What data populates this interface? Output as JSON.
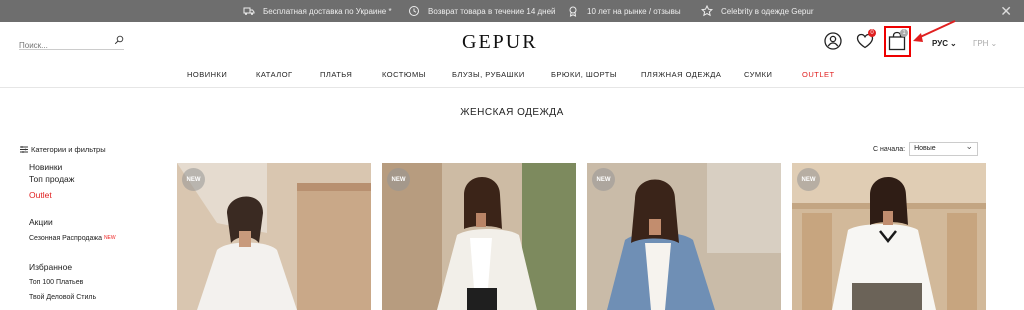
{
  "topbar": {
    "items": [
      {
        "label": "Бесплатная доставка по Украине *"
      },
      {
        "label": "Возврат товара в течение 14 дней"
      },
      {
        "label": "10 лет на рынке / отзывы"
      },
      {
        "label": "Celebrity в одежде Gepur"
      }
    ],
    "close": "✕"
  },
  "search": {
    "placeholder": "Поиск..."
  },
  "logo": "GEPUR",
  "header": {
    "wishlist_count": "0",
    "cart_count": "1",
    "lang": "РУС",
    "currency": "ГРН"
  },
  "nav": [
    "НОВИНКИ",
    "КАТАЛОГ",
    "ПЛАТЬЯ",
    "КОСТЮМЫ",
    "БЛУЗЫ, РУБАШКИ",
    "БРЮКИ, ШОРТЫ",
    "ПЛЯЖНАЯ ОДЕЖДА",
    "СУМКИ",
    "OUTLET"
  ],
  "page_title": "ЖЕНСКАЯ ОДЕЖДА",
  "filters_label": "Категории и фильтры",
  "sidebar": {
    "new": "Новинки",
    "top": "Топ продаж",
    "outlet": "Outlet",
    "promo_head": "Акции",
    "sale": "Сезонная Распродажа",
    "sale_tag": "NEW",
    "fav_head": "Избранное",
    "top100": "Топ 100 Платьев",
    "business": "Твой Деловой Стиль"
  },
  "sort": {
    "label": "С начала:",
    "value": "Новые"
  },
  "products": [
    {
      "badge": "NEW"
    },
    {
      "badge": "NEW"
    },
    {
      "badge": "NEW"
    },
    {
      "badge": "NEW"
    }
  ],
  "colors": {
    "accent": "#e02020",
    "topbar": "#6e6e6e"
  }
}
